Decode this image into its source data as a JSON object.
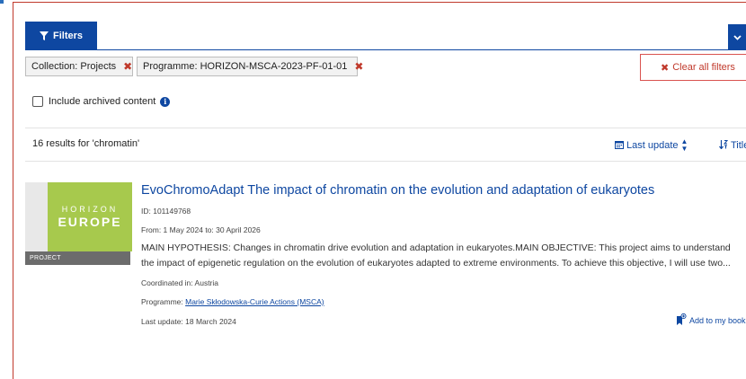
{
  "filters": {
    "tab_label": "Filters",
    "chips": [
      {
        "label": "Collection: Projects",
        "remove": "✖"
      },
      {
        "label": "Programme: HORIZON-MSCA-2023-PF-01-01",
        "remove": "✖"
      }
    ],
    "clear_all": {
      "icon": "✖",
      "label": "Clear all filters"
    }
  },
  "archived": {
    "label": "Include archived content",
    "checked": false
  },
  "results": {
    "count_text": "16 results for 'chromatin'",
    "sort_last_update": "Last update",
    "sort_title": "Title"
  },
  "item": {
    "thumbnail": {
      "line1": "HORIZON",
      "line2": "EUROPE",
      "type_label": "PROJECT"
    },
    "title": "EvoChromoAdapt The impact of chromatin on the evolution and adaptation of eukaryotes",
    "id": "ID: 101149768",
    "dates": "From: 1 May 2024 to: 30 April 2026",
    "description": "MAIN HYPOTHESIS: Changes in chromatin drive evolution and adaptation in eukaryotes.MAIN OBJECTIVE: This project aims to understand the impact of epigenetic regulation on the evolution of eukaryotes adapted to extreme environments. To achieve this objective, I will use two...",
    "coordinated_in": "Coordinated in: Austria",
    "programme_prefix": "Programme: ",
    "programme_link": "Marie Skłodowska-Curie Actions (MSCA)",
    "last_update": "Last update: 18 March 2024",
    "bookmark": "Add to my bookl"
  },
  "colors": {
    "primary": "#0e47a1",
    "danger": "#c0392b",
    "thumb_green": "#a7c94d"
  }
}
